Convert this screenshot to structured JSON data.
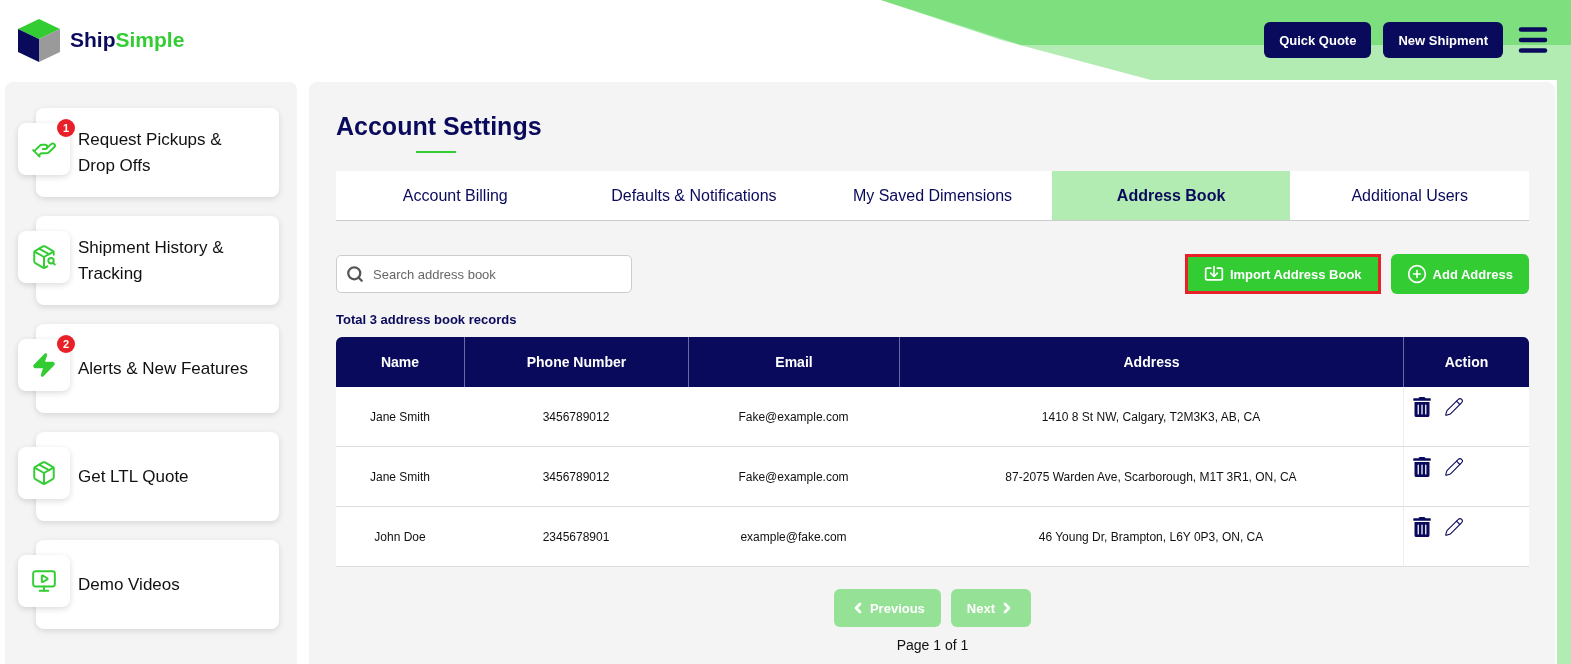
{
  "logo": {
    "first": "Ship",
    "second": "Simple"
  },
  "header_buttons": [
    "Quick Quote",
    "New Shipment"
  ],
  "sidebar": {
    "items": [
      {
        "label": "Request Pickups & Drop Offs",
        "badge": "1"
      },
      {
        "label": "Shipment History & Tracking"
      },
      {
        "label": "Alerts & New Features",
        "badge": "2"
      },
      {
        "label": "Get LTL Quote"
      },
      {
        "label": "Demo Videos"
      }
    ]
  },
  "title": "Account Settings",
  "tabs": [
    {
      "label": "Account Billing",
      "selected": false
    },
    {
      "label": "Defaults & Notifications",
      "selected": false
    },
    {
      "label": "My Saved Dimensions",
      "selected": false
    },
    {
      "label": "Address Book",
      "selected": true
    },
    {
      "label": "Additional Users",
      "selected": false
    }
  ],
  "search": {
    "placeholder": "Search address book"
  },
  "actions": [
    {
      "label": "Import Address Book",
      "highlighted": true
    },
    {
      "label": "Add Address",
      "highlighted": false
    }
  ],
  "summary": "Total 3 address book records",
  "table": {
    "columns": [
      "Name",
      "Phone Number",
      "Email",
      "Address",
      "Action"
    ],
    "rows": [
      [
        "Jane Smith",
        "3456789012",
        "Fake@example.com",
        "1410 8 St NW, Calgary, T2M3K3, AB, CA"
      ],
      [
        "Jane Smith",
        "3456789012",
        "Fake@example.com",
        "87-2075 Warden Ave, Scarborough, M1T 3R1, ON, CA"
      ],
      [
        "John Doe",
        "2345678901",
        "example@fake.com",
        "46 Young Dr, Brampton, L6Y 0P3, ON, CA"
      ]
    ]
  },
  "pagination": {
    "previous": {
      "label": "Previous",
      "disabled": true
    },
    "next": {
      "label": "Next",
      "disabled": true
    },
    "page": "Page 1 of 1"
  }
}
